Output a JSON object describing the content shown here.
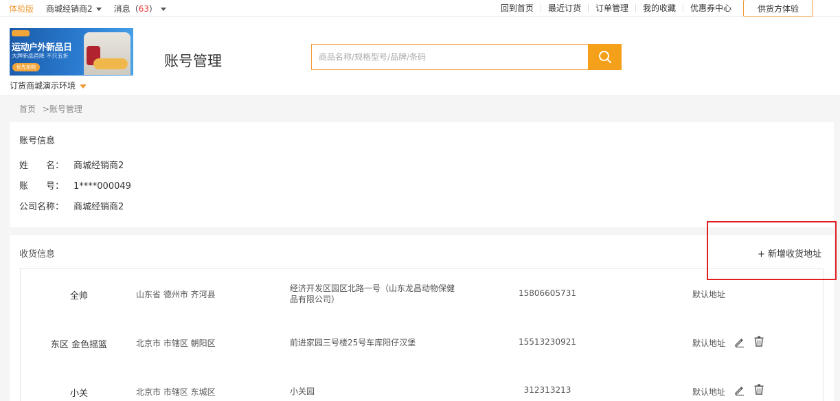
{
  "topbar": {
    "trial": "体验版",
    "account": "商城经销商2",
    "messages_label": "消息",
    "messages_count": "63",
    "links": [
      "回到首页",
      "最近订货",
      "订单管理",
      "我的收藏",
      "优惠券中心"
    ],
    "supplier_button": "供货方体验"
  },
  "header": {
    "banner": {
      "title": "运动户外新品日",
      "subtitle": "大牌新品首降 不只五折",
      "button": "优先抢购"
    },
    "environment": "订货商城演示环境",
    "page_title": "账号管理",
    "search_placeholder": "商品名称/规格型号/品牌/条码",
    "search_icon": "search-icon"
  },
  "breadcrumb": {
    "home": "首页",
    "separator": ">",
    "current": "账号管理"
  },
  "account": {
    "section_title": "账号信息",
    "name_label": [
      "姓",
      "名："
    ],
    "name_value": "商城经销商2",
    "id_label": [
      "账",
      "号："
    ],
    "id_value": "1****000049",
    "company_label": "公司名称：",
    "company_value": "商城经销商2"
  },
  "address": {
    "section_title": "收货信息",
    "add_button": "+ 新增收货地址",
    "highlight_color": "#e02020",
    "rows": [
      {
        "name": "全帅",
        "region": "山东省 德州市 齐河县",
        "detail": "经济开发区园区北路一号（山东龙昌动物保健品有限公司）",
        "phone": "15806605731",
        "default_label": "默认地址",
        "actions": false
      },
      {
        "name": "东区 金色摇篮",
        "region": "北京市 市辖区 朝阳区",
        "detail": "前进家园三号楼25号车库阳仔汉堡",
        "phone": "15513230921",
        "default_label": "默认地址",
        "actions": true
      },
      {
        "name": "小关",
        "region": "北京市 市辖区 东城区",
        "detail": "小关园",
        "phone": "312313213",
        "default_label": "默认地址",
        "actions": true
      }
    ]
  },
  "colors": {
    "accent": "#f19a38",
    "search_button": "#f5a01a",
    "count": "#e33333"
  }
}
